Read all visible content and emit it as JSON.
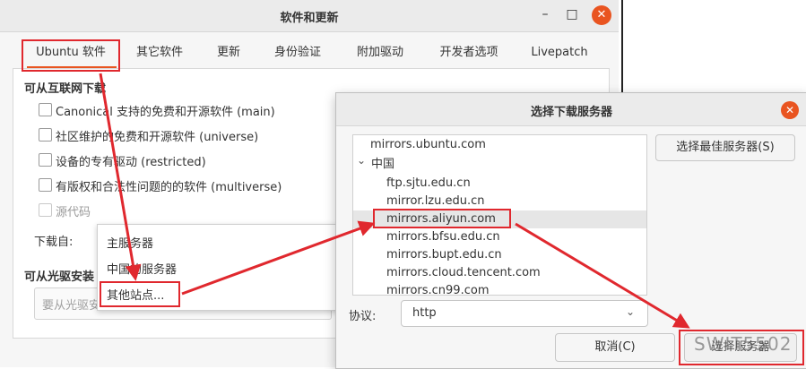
{
  "main_window": {
    "title": "软件和更新",
    "controls": {
      "minimize": "–",
      "maximize": "□",
      "close": "✕"
    },
    "tabs": [
      "Ubuntu 软件",
      "其它软件",
      "更新",
      "身份验证",
      "附加驱动",
      "开发者选项",
      "Livepatch"
    ],
    "internet_section_title": "可从互联网下载",
    "checkboxes": [
      "Canonical 支持的免费和开源软件 (main)",
      "社区维护的免费和开源软件 (universe)",
      "设备的专有驱动 (restricted)",
      "有版权和合法性问题的的软件 (multiverse)",
      "源代码"
    ],
    "download_from_label": "下载自:",
    "download_options": [
      "主服务器",
      "中国的服务器",
      "其他站点..."
    ],
    "cdrom_section_title": "可从光驱安装",
    "cdrom_placeholder": "要从光驱安装"
  },
  "server_dialog": {
    "title": "选择下载服务器",
    "close": "✕",
    "servers": {
      "top": "mirrors.ubuntu.com",
      "group_label": "中国",
      "group_chevron": "⌄",
      "items": [
        "ftp.sjtu.edu.cn",
        "mirror.lzu.edu.cn",
        "mirrors.aliyun.com",
        "mirrors.bfsu.edu.cn",
        "mirrors.bupt.edu.cn",
        "mirrors.cloud.tencent.com",
        "mirrors.cn99.com"
      ],
      "selected": "mirrors.aliyun.com"
    },
    "best_server_button": "选择最佳服务器(S)",
    "protocol_label": "协议:",
    "protocol_value": "http",
    "cancel_button": "取消(C)",
    "choose_button": "选择服务器"
  },
  "watermark": "SWIT5502",
  "colors": {
    "accent": "#e95420",
    "highlight": "#e0282e"
  }
}
